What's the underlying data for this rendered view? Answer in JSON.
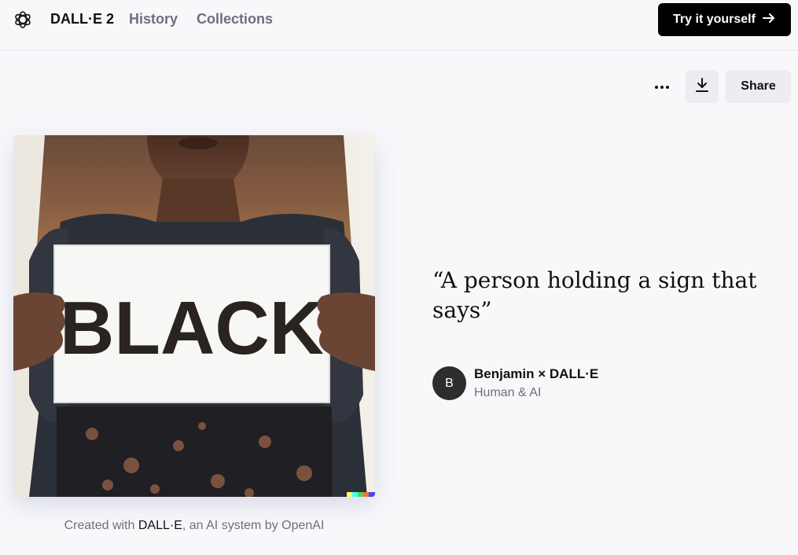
{
  "nav": {
    "brand": "DALL·E 2",
    "history": "History",
    "collections": "Collections",
    "cta": "Try it yourself"
  },
  "actions": {
    "more_icon": "ellipsis-icon",
    "download_icon": "download-icon",
    "share_label": "Share"
  },
  "image": {
    "sign_text": "BLACK"
  },
  "caption": {
    "prefix": "Created with ",
    "brand": "DALL·E",
    "suffix": ", an AI system by OpenAI"
  },
  "prompt": {
    "text": "“A person holding a sign that says”"
  },
  "author": {
    "initial": "B",
    "name": "Benjamin × DALL·E",
    "role": "Human & AI"
  },
  "colors": {
    "cta_bg": "#000000",
    "button_bg": "#ececf1",
    "muted_text": "#6e6e80",
    "page_bg": "#f8f8fb"
  }
}
